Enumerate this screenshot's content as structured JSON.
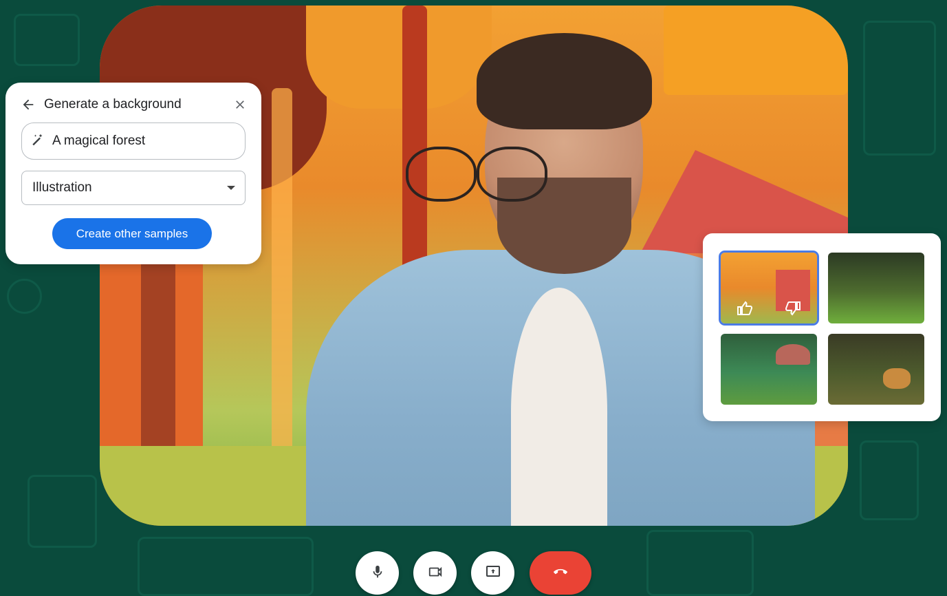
{
  "generate_panel": {
    "title": "Generate a background",
    "prompt_value": "A magical forest",
    "style_value": "Illustration",
    "create_button_label": "Create other samples"
  },
  "samples_panel": {
    "thumbnails": [
      {
        "subject": "forest cottage",
        "selected": true
      },
      {
        "subject": "dark jungle",
        "selected": false
      },
      {
        "subject": "mushroom house",
        "selected": false
      },
      {
        "subject": "deer in forest",
        "selected": false
      }
    ]
  },
  "controls": {
    "icons": [
      "microphone-icon",
      "camera-icon",
      "present-screen-icon",
      "end-call-icon"
    ],
    "end_call_color": "#ea4335"
  },
  "colors": {
    "page_background": "#0a4b3c",
    "accent": "#1a73e8",
    "selected_outline": "#4a7be5"
  }
}
